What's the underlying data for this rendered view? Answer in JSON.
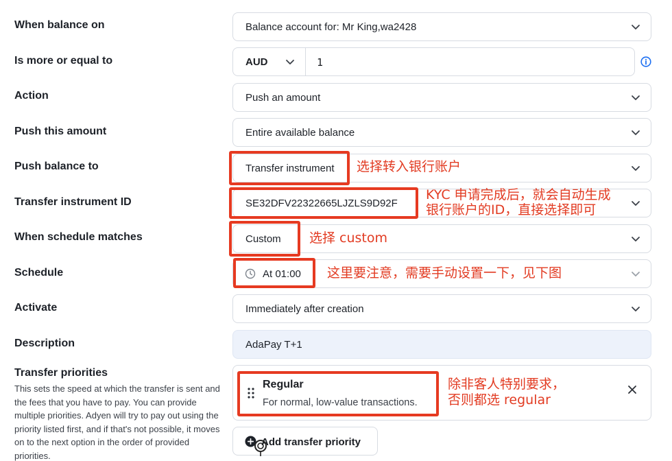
{
  "rows": [
    {
      "label": "When balance on",
      "value": "Balance account for: Mr King,wa2428"
    },
    {
      "label": "Is more or equal to",
      "currency": "AUD",
      "amount": "1"
    },
    {
      "label": "Action",
      "value": "Push an amount"
    },
    {
      "label": "Push this amount",
      "value": "Entire available balance"
    },
    {
      "label": "Push balance to",
      "value": "Transfer instrument"
    },
    {
      "label": "Transfer instrument ID",
      "value": "SE32DFV22322665LJZLS9D92F"
    },
    {
      "label": "When schedule matches",
      "value": "Custom"
    },
    {
      "label": "Schedule",
      "value": "At 01:00"
    },
    {
      "label": "Activate",
      "value": "Immediately after creation"
    },
    {
      "label": "Description",
      "value": "AdaPay T+1"
    }
  ],
  "priorities": {
    "label": "Transfer priorities",
    "description": "This sets the speed at which the transfer is sent and the fees that you have to pay. You can provide multiple priorities. Adyen will try to pay out using the priority listed first, and if that's not possible, it moves on to the next option in the order of provided priorities.",
    "item_title": "Regular",
    "item_subtitle": "For normal, low-value transactions.",
    "add_label": "Add transfer priority"
  },
  "notes": {
    "push_to": "选择转入银行账户",
    "instrument_id_1": "KYC 申请完成后，就会自动生成",
    "instrument_id_2": "银行账户的ID，直接选择即可",
    "schedule_match": "选择 custom",
    "schedule": "这里要注意，需要手动设置一下，见下图",
    "priority_1": "除非客人特别要求，",
    "priority_2": "否则都选 regular"
  },
  "colors": {
    "annotation": "#e63a21",
    "info": "#1d6ff2"
  }
}
